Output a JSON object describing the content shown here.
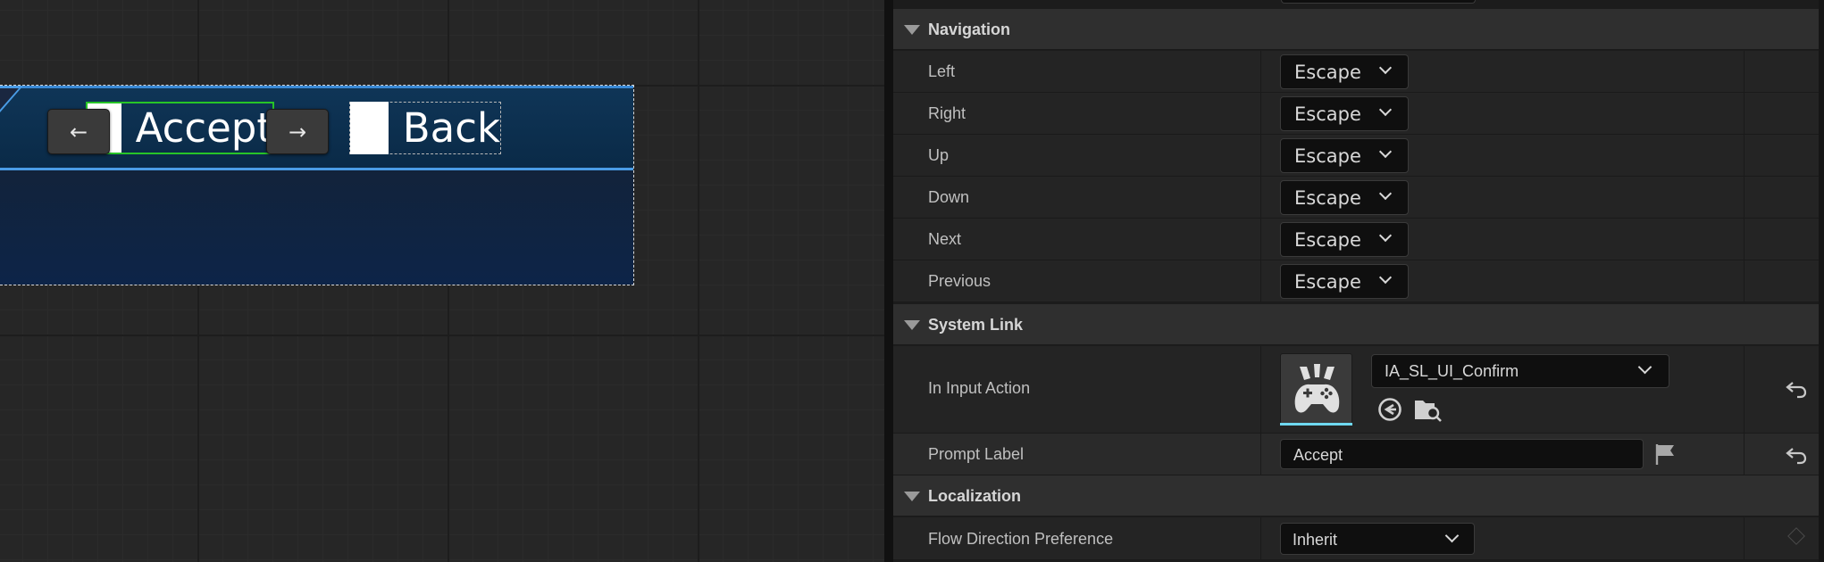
{
  "designer": {
    "prompts": [
      {
        "label": "Accept"
      },
      {
        "label": "Back"
      }
    ],
    "nav_prev_glyph": "←",
    "nav_next_glyph": "→",
    "selection_color": "#27c427",
    "bar_accent": "#4a9ce6"
  },
  "details": {
    "navigation": {
      "header": "Navigation",
      "rows": [
        {
          "label": "Left",
          "value": "Escape"
        },
        {
          "label": "Right",
          "value": "Escape"
        },
        {
          "label": "Up",
          "value": "Escape"
        },
        {
          "label": "Down",
          "value": "Escape"
        },
        {
          "label": "Next",
          "value": "Escape"
        },
        {
          "label": "Previous",
          "value": "Escape"
        }
      ]
    },
    "system_link": {
      "header": "System Link",
      "input_action": {
        "label": "In Input Action",
        "value": "IA_SL_UI_Confirm",
        "thumbnail_icon": "gamepad-icon",
        "thumb_accent": "#6fd8f0"
      },
      "prompt_label": {
        "label": "Prompt Label",
        "value": "Accept"
      }
    },
    "localization": {
      "header": "Localization",
      "flow_direction": {
        "label": "Flow Direction Preference",
        "value": "Inherit"
      }
    }
  }
}
